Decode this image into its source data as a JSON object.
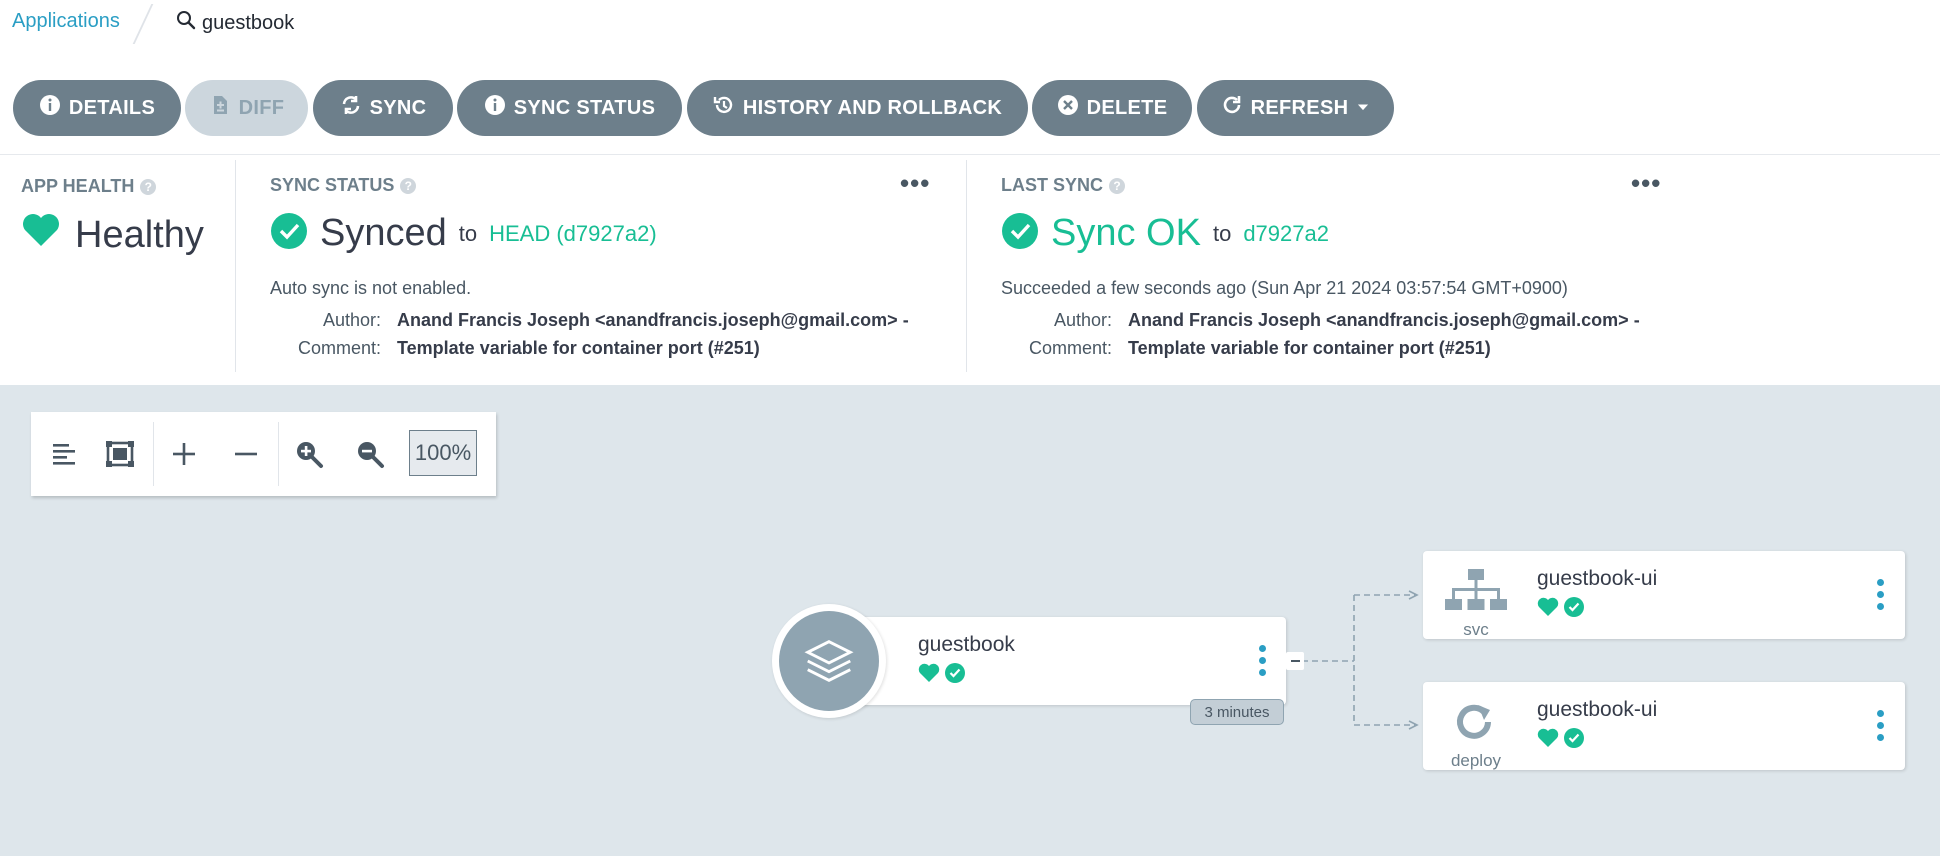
{
  "breadcrumb": {
    "applications": "Applications",
    "current": "guestbook"
  },
  "toolbar": {
    "details": "DETAILS",
    "diff": "DIFF",
    "sync": "SYNC",
    "sync_status": "SYNC STATUS",
    "history": "HISTORY AND ROLLBACK",
    "delete": "DELETE",
    "refresh": "REFRESH"
  },
  "app_health": {
    "label": "APP HEALTH",
    "value": "Healthy"
  },
  "sync_status": {
    "label": "SYNC STATUS",
    "value": "Synced",
    "to": "to",
    "revision": "HEAD (d7927a2)",
    "auto_sync": "Auto sync is not enabled.",
    "author_key": "Author:",
    "author": "Anand Francis Joseph <anandfrancis.joseph@gmail.com> -",
    "comment_key": "Comment:",
    "comment": "Template variable for container port (#251)"
  },
  "last_sync": {
    "label": "LAST SYNC",
    "value": "Sync OK",
    "to": "to",
    "revision": "d7927a2",
    "succeeded": "Succeeded a few seconds ago (Sun Apr 21 2024 03:57:54 GMT+0900)",
    "author_key": "Author:",
    "author": "Anand Francis Joseph <anandfrancis.joseph@gmail.com> -",
    "comment_key": "Comment:",
    "comment": "Template variable for container port (#251)"
  },
  "zoom": {
    "value": "100%"
  },
  "graph": {
    "app_node": {
      "name": "guestbook",
      "age": "3 minutes"
    },
    "svc_node": {
      "name": "guestbook-ui",
      "kind": "svc"
    },
    "deploy_node": {
      "name": "guestbook-ui",
      "kind": "deploy"
    }
  },
  "colors": {
    "accent": "#18be94",
    "link": "#2a9ec4",
    "button": "#6d7f8b",
    "canvas": "#dee6eb"
  }
}
